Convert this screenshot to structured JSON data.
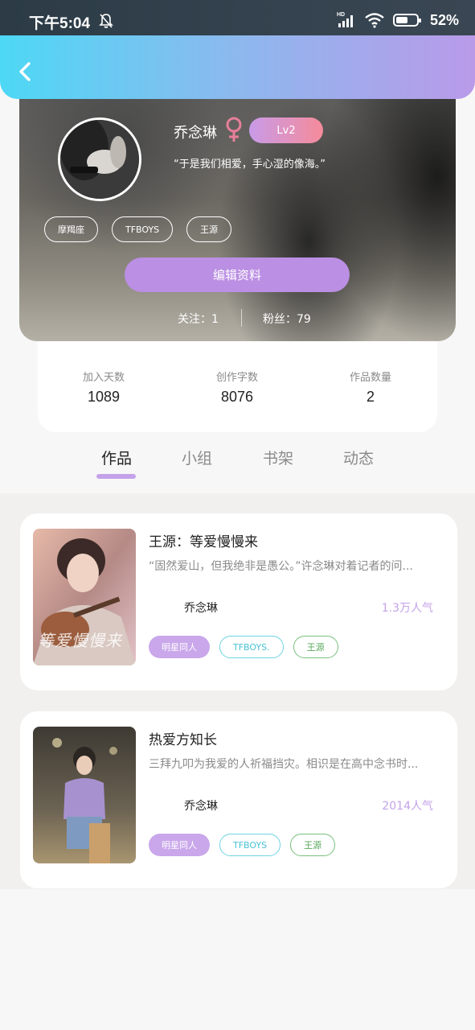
{
  "status_bar": {
    "time": "下午5:04",
    "network": "HD",
    "battery": "52%"
  },
  "header": {
    "back_icon": "chevron-left-icon"
  },
  "profile": {
    "name": "乔念琳",
    "gender_icon": "female-icon",
    "gender_color": "#e77f9a",
    "level": "Lv2",
    "motto": "“于是我们相爱，手心湿的像海。”",
    "tags": [
      "摩羯座",
      "TFBOYS",
      "王源"
    ],
    "edit_button": "编辑资料",
    "following": "关注：1",
    "fans": "粉丝：79"
  },
  "stats": [
    {
      "label": "加入天数",
      "value": "1089"
    },
    {
      "label": "创作字数",
      "value": "8076"
    },
    {
      "label": "作品数量",
      "value": "2"
    }
  ],
  "tabs": [
    {
      "label": "作品",
      "active": true
    },
    {
      "label": "小组",
      "active": false
    },
    {
      "label": "书架",
      "active": false
    },
    {
      "label": "动态",
      "active": false
    }
  ],
  "works": [
    {
      "title": "王源：等爱慢慢来",
      "description": "“固然爱山，但我绝非是愚公。”许念琳对着记者的问...",
      "author": "乔念琳",
      "popularity": "1.3万人气",
      "cover_text": "等爱慢慢来",
      "tags": [
        "明星同人",
        "TFBOYS.",
        "王源"
      ]
    },
    {
      "title": "热爱方知长",
      "description": "三拜九叩为我爱的人祈福挡灾。相识是在高中念书时...",
      "author": "乔念琳",
      "popularity": "2014人气",
      "cover_text": "",
      "tags": [
        "明星同人",
        "TFBOYS",
        "王源"
      ]
    }
  ],
  "colors": {
    "accent": "#bb8fe3",
    "header_gradient_start": "#4dd8f5",
    "header_gradient_end": "#b99ae9",
    "popularity": "#c4a2e9"
  }
}
